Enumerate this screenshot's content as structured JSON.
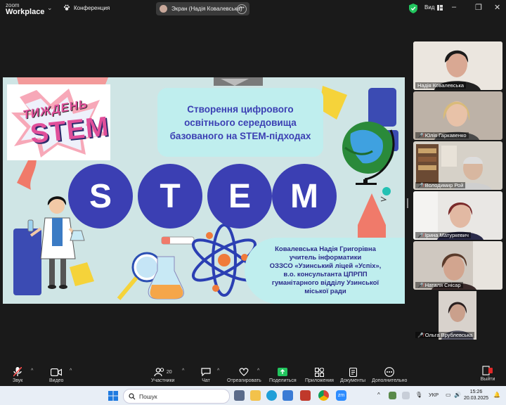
{
  "app": {
    "logo_line1": "zoom",
    "logo_line2": "Workplace",
    "conference_label": "Конференция",
    "screen_share_label": "Экран (Надія Ковалевська)",
    "view_label": "Вид",
    "security_color": "#22c55e"
  },
  "slide": {
    "badge_top": "ТИЖДЕНЬ",
    "badge_bottom": "STEM",
    "title": "Створення цифрового освітнього середовища базованого на STEM-підходах",
    "letters": [
      "S",
      "T",
      "E",
      "M"
    ],
    "author_lines": [
      "Ковалевська Надія Григорівна",
      "учитель інформатики",
      "ОЗЗСО «Узинський ліцей «Успіх»,",
      "в.о. консультанта ЦПРПП",
      "гуманітарного відділу Узинської",
      "міської ради"
    ],
    "colors": {
      "background": "#cfe5e5",
      "circle": "#3b3fb3",
      "title_text": "#3b3fb3",
      "title_box": "#bfeeee"
    }
  },
  "participants": [
    {
      "name": "Надія Ковалевська",
      "muted": false
    },
    {
      "name": "Юлія Гаркавенко",
      "muted": true
    },
    {
      "name": "Володимир Рой",
      "muted": true
    },
    {
      "name": "Ірина Матуркевич",
      "muted": true
    },
    {
      "name": "Наталя Снісар",
      "muted": true
    },
    {
      "name": "Ольга Врублевська",
      "muted": true
    }
  ],
  "toolbar": {
    "audio": "Звук",
    "video": "Видео",
    "participants": "Участники",
    "participants_count": "20",
    "chat": "Чат",
    "react": "Отреагировать",
    "share": "Поделиться",
    "apps": "Приложения",
    "docs": "Документы",
    "more": "Дополнительно",
    "exit": "Выйти"
  },
  "taskbar": {
    "search_placeholder": "Пошук",
    "lang": "УКР",
    "time": "15:26",
    "date": "20.03.2025"
  }
}
